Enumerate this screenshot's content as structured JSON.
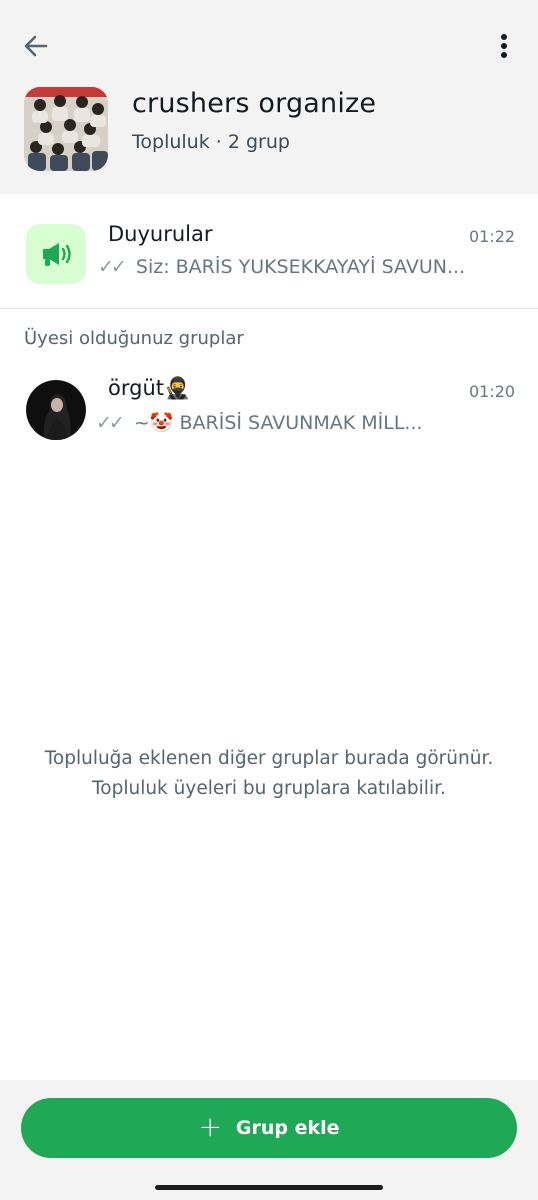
{
  "header": {
    "back_icon": "arrow-left-icon",
    "menu_icon": "more-vertical-icon",
    "title": "crushers organize",
    "subtitle": "Topluluk · 2 grup"
  },
  "announcements": {
    "icon": "megaphone-icon",
    "title": "Duyurular",
    "time": "01:22",
    "ticks": "✓✓",
    "message": "Siz: BARİS YUKSEKKAYAYİ SAVUN..."
  },
  "section_label": "Üyesi olduğunuz gruplar",
  "groups": [
    {
      "title": "örgüt🥷",
      "time": "01:20",
      "ticks": "✓✓",
      "message": "~🤡 BARİSİ SAVUNMAK MİLL..."
    }
  ],
  "empty_state": {
    "line1": "Topluluğa eklenen diğer gruplar burada görünür.",
    "line2": "Topluluk üyeleri bu gruplara katılabilir."
  },
  "add_group": {
    "icon": "plus-icon",
    "label": "Grup ekle"
  },
  "colors": {
    "accent": "#1fa855",
    "announce_bg": "#d9fdd3",
    "header_bg": "#f3f3f3"
  }
}
